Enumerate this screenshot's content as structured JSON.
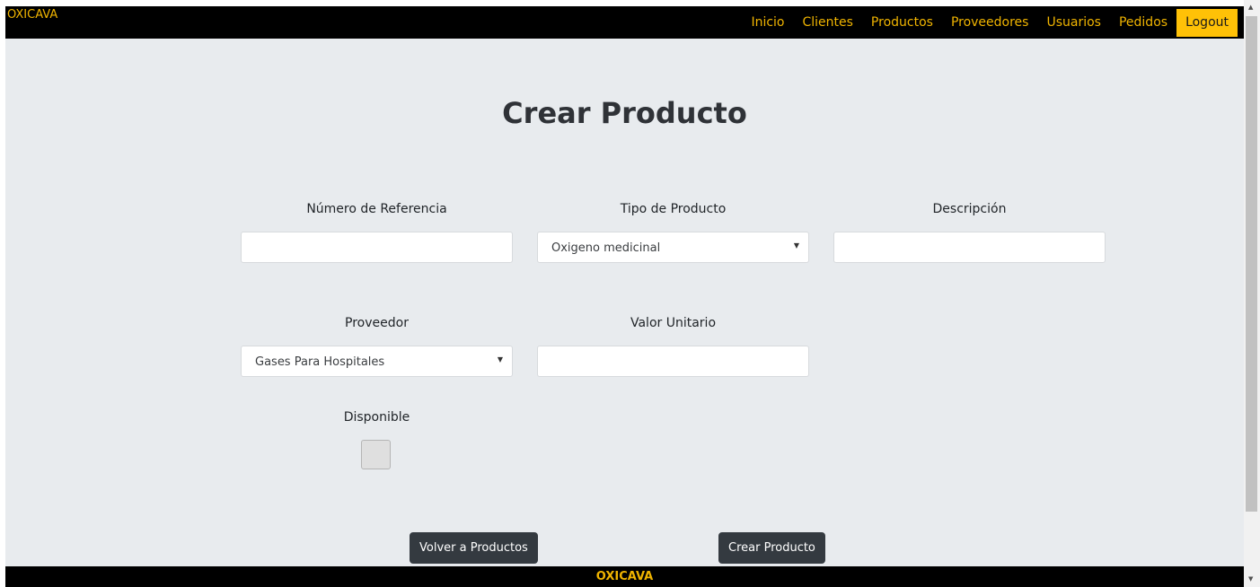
{
  "navbar": {
    "brand": "OXICAVA",
    "links": [
      "Inicio",
      "Clientes",
      "Productos",
      "Proveedores",
      "Usuarios",
      "Pedidos"
    ],
    "logout_label": "Logout"
  },
  "page": {
    "title": "Crear Producto"
  },
  "form": {
    "reference": {
      "label": "Número de Referencia",
      "value": ""
    },
    "product_type": {
      "label": "Tipo de Producto",
      "selected": "Oxigeno medicinal"
    },
    "description": {
      "label": "Descripción",
      "value": ""
    },
    "supplier": {
      "label": "Proveedor",
      "selected": "Gases Para Hospitales"
    },
    "unit_value": {
      "label": "Valor Unitario",
      "value": ""
    },
    "available": {
      "label": "Disponible",
      "checked": false
    }
  },
  "actions": {
    "back_label": "Volver a Productos",
    "create_label": "Crear Producto"
  },
  "footer": {
    "brand": "OXICAVA"
  },
  "colors": {
    "accent": "#f0b400",
    "logout_bg": "#ffc107",
    "navbar_bg": "#000000",
    "page_bg": "#e8ebee",
    "button_bg": "#343a40"
  },
  "icons": {
    "select_caret": "caret-down-icon"
  }
}
